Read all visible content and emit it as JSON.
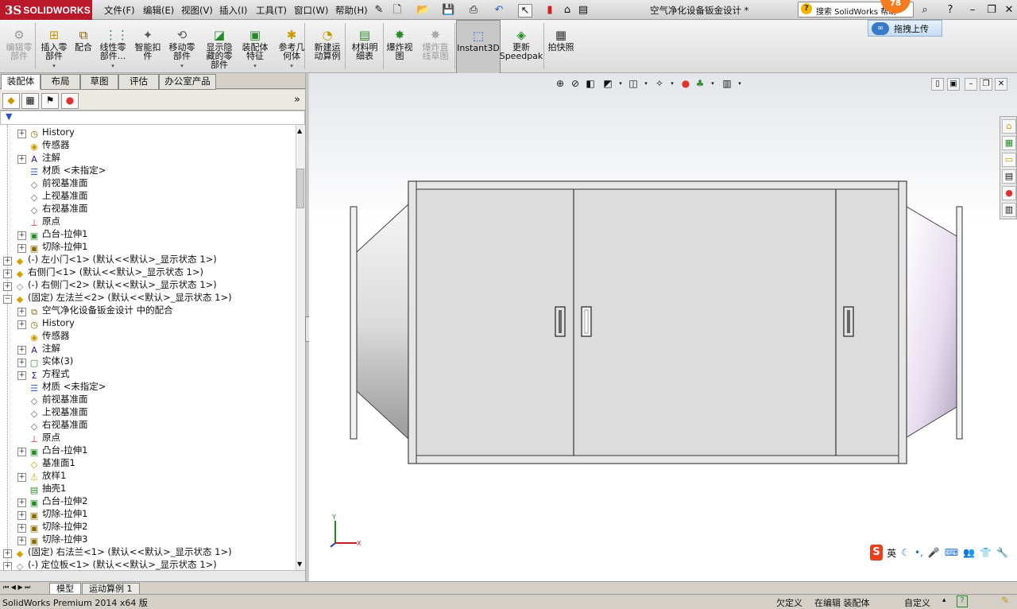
{
  "app": {
    "logo_prefix": "3S",
    "logo_text": "SOLIDWORKS",
    "document_title": "空气净化设备钣金设计 *"
  },
  "menu": [
    {
      "label": "文件(F)"
    },
    {
      "label": "编辑(E)"
    },
    {
      "label": "视图(V)"
    },
    {
      "label": "插入(I)"
    },
    {
      "label": "工具(T)"
    },
    {
      "label": "窗口(W)"
    },
    {
      "label": "帮助(H)"
    }
  ],
  "search": {
    "icon_text": "?",
    "text": "搜索 SolidWorks 帮助"
  },
  "notification_badge": "78",
  "cloud_upload": {
    "icon_text": "∞",
    "label": "拖拽上传"
  },
  "command_manager": [
    {
      "label": "编辑零部件",
      "lines": [
        "编辑零",
        "部件"
      ],
      "disabled": true
    },
    {
      "label": "插入零部件",
      "lines": [
        "插入零",
        "部件"
      ],
      "arrow": true
    },
    {
      "label": "配合",
      "lines": [
        "配合"
      ]
    },
    {
      "label": "线性零部件...",
      "lines": [
        "线性零",
        "部件..."
      ],
      "arrow": true
    },
    {
      "label": "智能扣件",
      "lines": [
        "智能扣",
        "件"
      ]
    },
    {
      "label": "移动零部件",
      "lines": [
        "移动零",
        "部件"
      ],
      "arrow": true
    },
    {
      "label": "显示隐藏的零部件",
      "lines": [
        "显示隐",
        "藏的零",
        "部件"
      ]
    },
    {
      "label": "装配体特征",
      "lines": [
        "装配体",
        "特征"
      ],
      "arrow": true
    },
    {
      "label": "参考几何体",
      "lines": [
        "参考几",
        "何体"
      ],
      "arrow": true
    },
    {
      "label": "新建运动算例",
      "lines": [
        "新建运",
        "动算例"
      ]
    },
    {
      "label": "材料明细表",
      "lines": [
        "材料明",
        "细表"
      ]
    },
    {
      "label": "爆炸视图",
      "lines": [
        "爆炸视",
        "图"
      ]
    },
    {
      "label": "爆炸直线草图",
      "lines": [
        "爆炸直",
        "线草图"
      ],
      "disabled": true
    },
    {
      "label": "Instant3D",
      "lines": [
        "Instant3D"
      ],
      "active": true
    },
    {
      "label": "更新Speedpak",
      "lines": [
        "更新",
        "Speedpak"
      ]
    },
    {
      "label": "拍快照",
      "lines": [
        "拍快照"
      ]
    }
  ],
  "tabs": [
    {
      "label": "装配体",
      "active": true
    },
    {
      "label": "布局"
    },
    {
      "label": "草图"
    },
    {
      "label": "评估"
    },
    {
      "label": "办公室产品"
    }
  ],
  "pm_more": "»",
  "filter_label": "▼",
  "tree": [
    {
      "indent": 2,
      "exp": "+",
      "icon": "history",
      "label": "History"
    },
    {
      "indent": 2,
      "exp": "",
      "icon": "sensor",
      "label": "传感器"
    },
    {
      "indent": 2,
      "exp": "+",
      "icon": "annotation",
      "label": "注解"
    },
    {
      "indent": 2,
      "exp": "",
      "icon": "material",
      "label": "材质 <未指定>"
    },
    {
      "indent": 2,
      "exp": "",
      "icon": "plane",
      "label": "前视基准面"
    },
    {
      "indent": 2,
      "exp": "",
      "icon": "plane",
      "label": "上视基准面"
    },
    {
      "indent": 2,
      "exp": "",
      "icon": "plane",
      "label": "右视基准面"
    },
    {
      "indent": 2,
      "exp": "",
      "icon": "origin",
      "label": "原点"
    },
    {
      "indent": 2,
      "exp": "+",
      "icon": "boss",
      "label": "凸台-拉伸1"
    },
    {
      "indent": 2,
      "exp": "+",
      "icon": "cut",
      "label": "切除-拉伸1"
    },
    {
      "indent": 0,
      "exp": "+",
      "icon": "part",
      "label": "(-) 左小门<1> (默认<<默认>_显示状态 1>)"
    },
    {
      "indent": 0,
      "exp": "+",
      "icon": "part",
      "label": "右侧门<1> (默认<<默认>_显示状态 1>)"
    },
    {
      "indent": 0,
      "exp": "+",
      "icon": "part-gray",
      "label": "(-) 右侧门<2> (默认<<默认>_显示状态 1>)"
    },
    {
      "indent": 0,
      "exp": "-",
      "icon": "part",
      "label": "(固定) 左法兰<2> (默认<<默认>_显示状态 1>)"
    },
    {
      "indent": 2,
      "exp": "+",
      "icon": "mates",
      "label": "空气净化设备钣金设计 中的配合"
    },
    {
      "indent": 2,
      "exp": "+",
      "icon": "history",
      "label": "History"
    },
    {
      "indent": 2,
      "exp": "",
      "icon": "sensor",
      "label": "传感器"
    },
    {
      "indent": 2,
      "exp": "+",
      "icon": "annotation",
      "label": "注解"
    },
    {
      "indent": 2,
      "exp": "+",
      "icon": "solid",
      "label": "实体(3)"
    },
    {
      "indent": 2,
      "exp": "+",
      "icon": "equation",
      "label": "方程式"
    },
    {
      "indent": 2,
      "exp": "",
      "icon": "material",
      "label": "材质 <未指定>"
    },
    {
      "indent": 2,
      "exp": "",
      "icon": "plane",
      "label": "前视基准面"
    },
    {
      "indent": 2,
      "exp": "",
      "icon": "plane",
      "label": "上视基准面"
    },
    {
      "indent": 2,
      "exp": "",
      "icon": "plane",
      "label": "右视基准面"
    },
    {
      "indent": 2,
      "exp": "",
      "icon": "origin",
      "label": "原点"
    },
    {
      "indent": 2,
      "exp": "+",
      "icon": "boss",
      "label": "凸台-拉伸1"
    },
    {
      "indent": 2,
      "exp": "",
      "icon": "plane-y",
      "label": "基准面1"
    },
    {
      "indent": 2,
      "exp": "+",
      "icon": "loft",
      "label": "放样1"
    },
    {
      "indent": 2,
      "exp": "",
      "icon": "shell",
      "label": "抽壳1"
    },
    {
      "indent": 2,
      "exp": "+",
      "icon": "boss",
      "label": "凸台-拉伸2"
    },
    {
      "indent": 2,
      "exp": "+",
      "icon": "cut",
      "label": "切除-拉伸1"
    },
    {
      "indent": 2,
      "exp": "+",
      "icon": "cut",
      "label": "切除-拉伸2"
    },
    {
      "indent": 2,
      "exp": "+",
      "icon": "cut",
      "label": "切除-拉伸3"
    },
    {
      "indent": 0,
      "exp": "+",
      "icon": "part",
      "label": "(固定) 右法兰<1> (默认<<默认>_显示状态 1>)"
    },
    {
      "indent": 0,
      "exp": "+",
      "icon": "part-gray",
      "label": "(-) 定位板<1> (默认<<默认>_显示状态 1>)"
    }
  ],
  "bottom_tabs": [
    {
      "label": "模型",
      "active": true
    },
    {
      "label": "运动算例 1"
    }
  ],
  "triad": {
    "x": "X",
    "y": "Y"
  },
  "ime": {
    "logo": "S",
    "label": "英"
  },
  "status": {
    "product": "SolidWorks Premium 2014 x64 版",
    "underdefined": "欠定义",
    "editing": "在编辑 装配体",
    "custom": "自定义",
    "custom_arrow": "▴",
    "help": "?"
  },
  "colors": {
    "brand": "#b9192a",
    "accent": "#3779c6",
    "model_fill": "#d9d9d9",
    "model_edge": "#3a3a3a"
  }
}
